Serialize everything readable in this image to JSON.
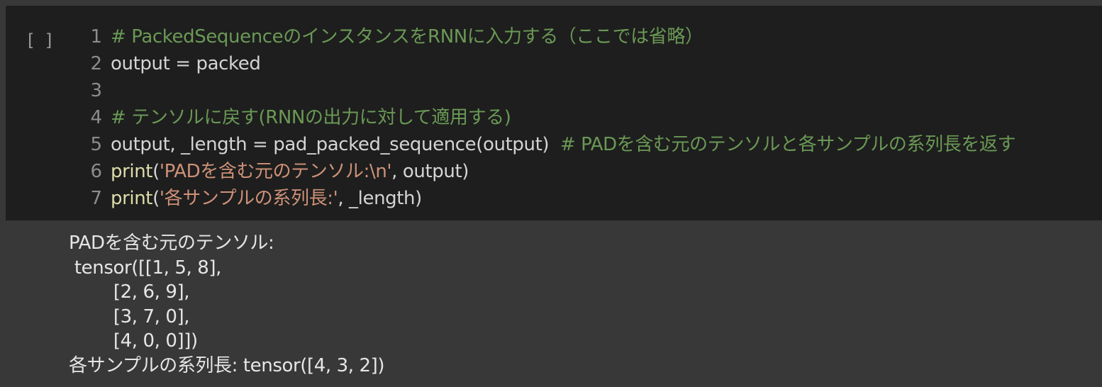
{
  "cell": {
    "run_indicator": "[ ]",
    "code": [
      {
        "num": "1",
        "parts": [
          {
            "t": "# PackedSequenceのインスタンスをRNNに入力する（ここでは省略）",
            "c": "cmt"
          }
        ]
      },
      {
        "num": "2",
        "parts": [
          {
            "t": "output = packed",
            "c": "plain"
          }
        ]
      },
      {
        "num": "3",
        "parts": []
      },
      {
        "num": "4",
        "parts": [
          {
            "t": "# テンソルに戻す(RNNの出力に対して適用する)",
            "c": "cmt"
          }
        ]
      },
      {
        "num": "5",
        "parts": [
          {
            "t": "output, _length = pad_packed_sequence(output)  ",
            "c": "plain"
          },
          {
            "t": "# PADを含む元のテンソルと各サンプルの系列長を返す",
            "c": "cmt"
          }
        ]
      },
      {
        "num": "6",
        "parts": [
          {
            "t": "print",
            "c": "fn"
          },
          {
            "t": "(",
            "c": "plain"
          },
          {
            "t": "'PADを含む元のテンソル:\\n'",
            "c": "str"
          },
          {
            "t": ", output)",
            "c": "plain"
          }
        ]
      },
      {
        "num": "7",
        "parts": [
          {
            "t": "print",
            "c": "fn"
          },
          {
            "t": "(",
            "c": "plain"
          },
          {
            "t": "'各サンプルの系列長:'",
            "c": "str"
          },
          {
            "t": ", _length)",
            "c": "plain"
          }
        ]
      }
    ],
    "output": [
      "PADを含む元のテンソル:",
      " tensor([[1, 5, 8],",
      "        [2, 6, 9],",
      "        [3, 7, 0],",
      "        [4, 0, 0]])",
      "各サンプルの系列長: tensor([4, 3, 2])"
    ]
  },
  "colors": {
    "comment": "#6a9955",
    "function": "#dcdcaa",
    "string": "#ce9178",
    "text": "#d4d4d4",
    "code_bg": "#1e1e1e",
    "output_bg": "#383838"
  }
}
